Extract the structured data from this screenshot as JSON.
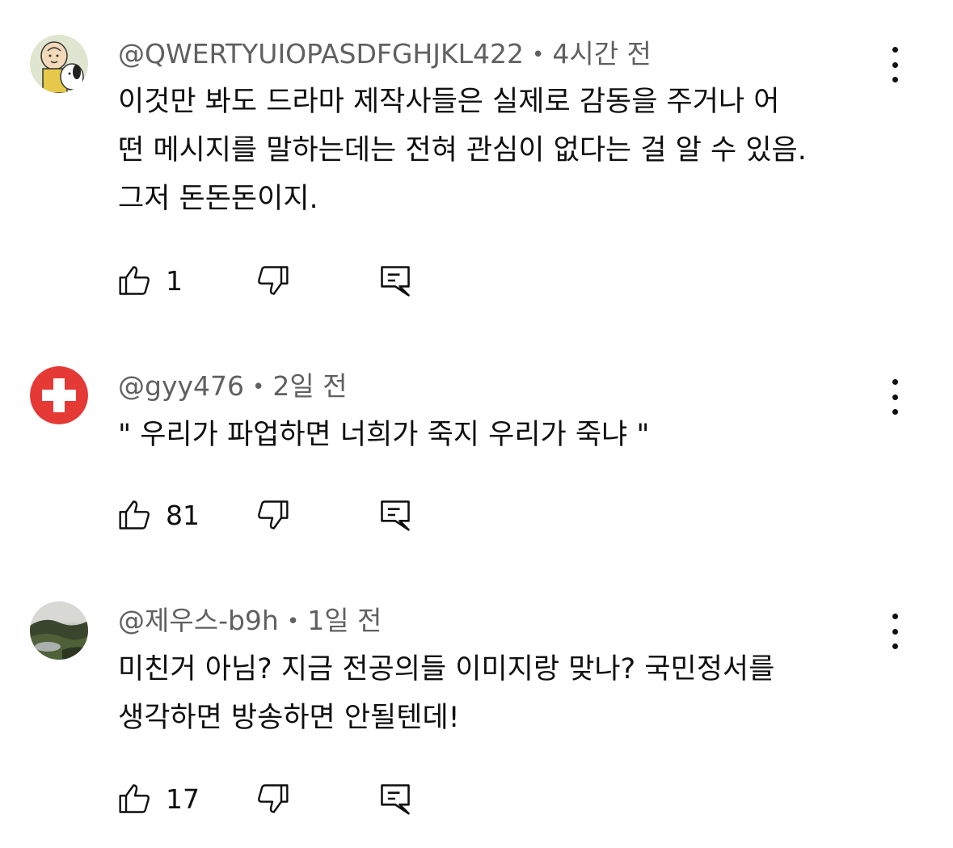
{
  "comments": [
    {
      "author": "@QWERTYUIOPASDFGHJKL422",
      "time": "4시간 전",
      "lines": [
        "이것만 봐도 드라마 제작사들은 실제로 감동을 주거나 어",
        "떤 메시지를 말하는데는 전혀 관심이 없다는 걸 알 수 있음.",
        "그저 돈돈돈이지."
      ],
      "likes": "1",
      "avatar_icon": "snoopy-avatar-icon"
    },
    {
      "author": "@gyy476",
      "time": "2일 전",
      "lines": [
        "\" 우리가 파업하면 너희가 죽지 우리가 죽냐 \""
      ],
      "likes": "81",
      "avatar_icon": "swiss-cross-avatar-icon"
    },
    {
      "author": "@제우스-b9h",
      "time": "1일 전",
      "lines": [
        "미친거 아님? 지금 전공의들 이미지랑 맞나? 국민정서를",
        "생각하면 방송하면 안될텐데!"
      ],
      "likes": "17",
      "avatar_icon": "landscape-avatar-icon"
    }
  ],
  "separator": "•",
  "colors": {
    "text": "#0f0f0f",
    "meta": "#606060",
    "swiss_red": "#e53935"
  }
}
